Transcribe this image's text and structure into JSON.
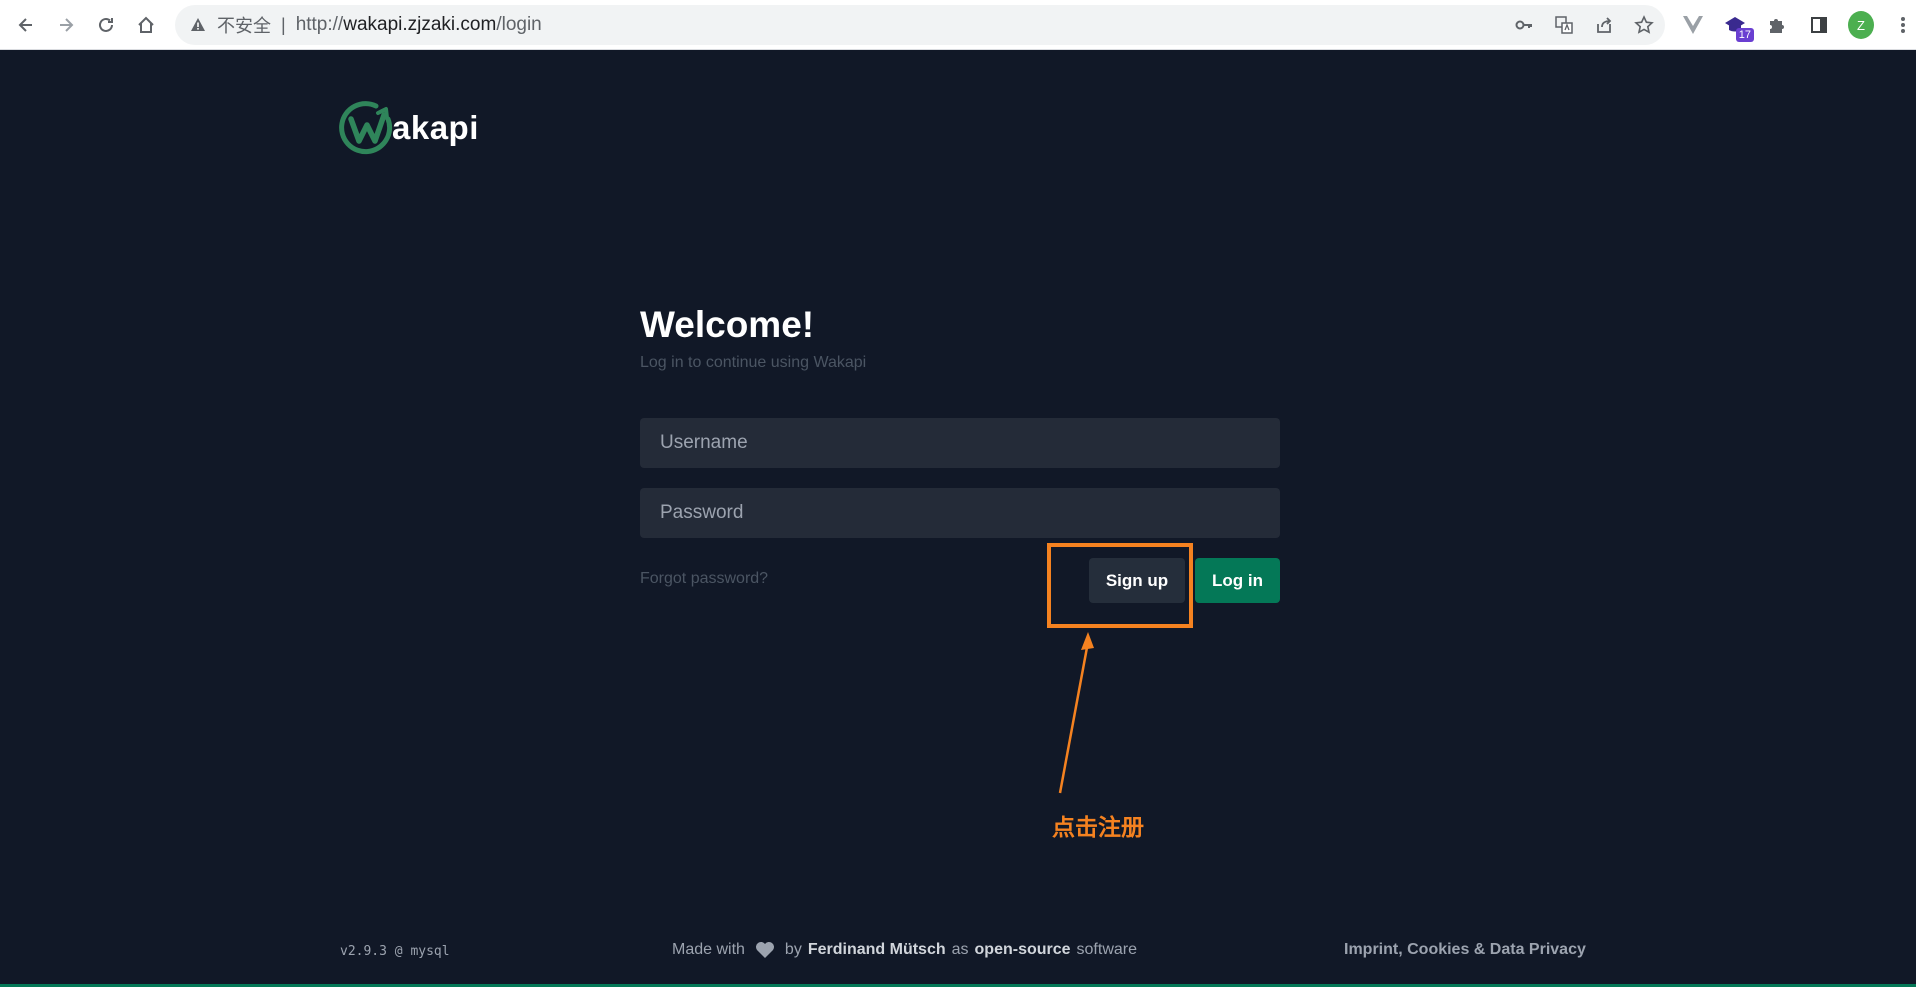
{
  "browser": {
    "insecure_label": "不安全",
    "separator": "|",
    "url_prefix": "http://",
    "url_host": "wakapi.zjzaki.com",
    "url_path": "/login",
    "extension_badge": "17",
    "profile_initial": "Z"
  },
  "logo": {
    "text": "akapi",
    "brand_color": "#2f855a"
  },
  "login": {
    "title": "Welcome!",
    "subtitle": "Log in to continue using Wakapi",
    "username_placeholder": "Username",
    "password_placeholder": "Password",
    "forgot_label": "Forgot password?",
    "signup_label": "Sign up",
    "login_label": "Log in"
  },
  "annotation": {
    "text": "点击注册",
    "color": "#f58220"
  },
  "footer": {
    "version": "v2.9.3 @ mysql",
    "made_with": "Made with",
    "by": "by",
    "author": "Ferdinand Mütsch",
    "as": "as",
    "open_source": "open-source",
    "software": "software",
    "legal": "Imprint, Cookies & Data Privacy"
  },
  "icons": {
    "back": "arrow-left-icon",
    "forward": "arrow-right-icon",
    "reload": "reload-icon",
    "home": "home-icon",
    "warning": "warning-triangle-icon",
    "key": "key-icon",
    "translate": "translate-icon",
    "share": "share-icon",
    "star": "star-icon",
    "extension": "puzzle-icon",
    "sidepanel": "side-panel-icon",
    "menu": "more-vert-icon",
    "heart": "heart-icon"
  }
}
